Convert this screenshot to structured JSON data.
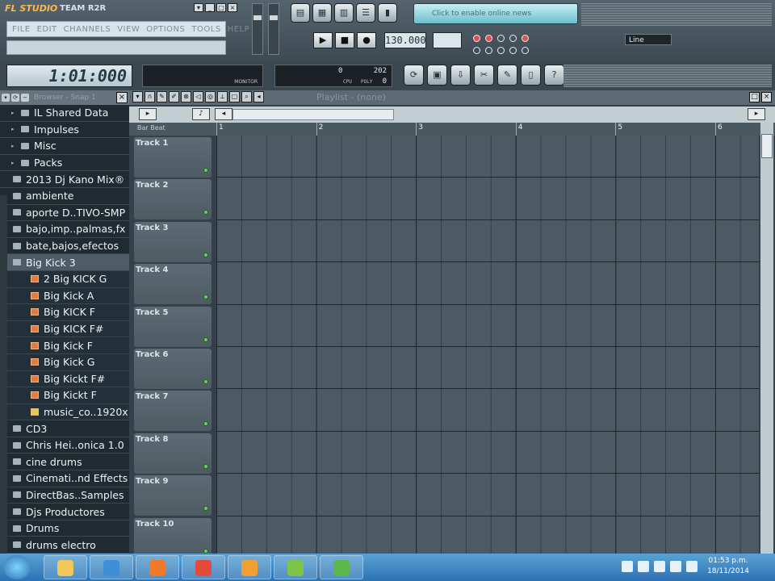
{
  "app": {
    "logo": "FL STUDIO",
    "team": "TEAM R2R",
    "menu": [
      "FILE",
      "EDIT",
      "CHANNELS",
      "VIEW",
      "OPTIONS",
      "TOOLS",
      "HELP"
    ],
    "time_display": "1:01:000",
    "tempo": "130.000",
    "cpu_value_1": "0",
    "cpu_value_2": "202",
    "cpu_value_3": "0",
    "cpu_label": "CPU",
    "poly_label": "POLY",
    "monitor_label": "MONITOR",
    "line_select": "Line",
    "browser_search": "Click to enable online news"
  },
  "browser": {
    "title": "Browser - Snap 1",
    "items": [
      {
        "label": "IL Shared Data",
        "type": "folder",
        "level": 0
      },
      {
        "label": "Impulses",
        "type": "folder",
        "level": 0
      },
      {
        "label": "Misc",
        "type": "folder",
        "level": 0
      },
      {
        "label": "Packs",
        "type": "folder",
        "level": 0
      },
      {
        "label": "2013 Dj Kano Mix®",
        "type": "folder",
        "level": 1
      },
      {
        "label": "ambiente",
        "type": "folder",
        "level": 1
      },
      {
        "label": "aporte D..TIVO-SMP",
        "type": "folder",
        "level": 1
      },
      {
        "label": "bajo,imp..palmas,fx",
        "type": "folder",
        "level": 1
      },
      {
        "label": "bate,bajos,efectos",
        "type": "folder",
        "level": 1
      },
      {
        "label": "Big Kick 3",
        "type": "folder",
        "level": 1,
        "selected": true
      },
      {
        "label": "2 Big KICK G",
        "type": "file",
        "level": 2
      },
      {
        "label": "Big  Kick A",
        "type": "file",
        "level": 2
      },
      {
        "label": "Big KICK  F",
        "type": "file",
        "level": 2
      },
      {
        "label": "Big KICK F#",
        "type": "file",
        "level": 2
      },
      {
        "label": "Big Kick F",
        "type": "file",
        "level": 2
      },
      {
        "label": "Big Kick G",
        "type": "file",
        "level": 2
      },
      {
        "label": "Big Kickt F#",
        "type": "file",
        "level": 2
      },
      {
        "label": "Big Kickt F",
        "type": "file",
        "level": 2
      },
      {
        "label": "music_co..1920x1080",
        "type": "image",
        "level": 2
      },
      {
        "label": "CD3",
        "type": "folder",
        "level": 1
      },
      {
        "label": "Chris Hei..onica 1.0",
        "type": "folder",
        "level": 1
      },
      {
        "label": "cine drums",
        "type": "folder",
        "level": 1
      },
      {
        "label": "Cinemati..nd Effects",
        "type": "folder",
        "level": 1
      },
      {
        "label": "DirectBas..Samples",
        "type": "folder",
        "level": 1
      },
      {
        "label": "Djs Productores",
        "type": "folder",
        "level": 1
      },
      {
        "label": "Drums",
        "type": "folder",
        "level": 1
      },
      {
        "label": "drums electro",
        "type": "folder",
        "level": 1
      }
    ]
  },
  "playlist": {
    "title": "Playlist - (none)",
    "ruler_label": "Bar   Beat",
    "bars": [
      "1",
      "2",
      "3",
      "4",
      "5",
      "6"
    ],
    "tracks": [
      "Track 1",
      "Track 2",
      "Track 3",
      "Track 4",
      "Track 5",
      "Track 6",
      "Track 7",
      "Track 8",
      "Track 9",
      "Track 10"
    ]
  },
  "taskbar": {
    "time": "01:53 p.m.",
    "date": "18/11/2014",
    "apps": [
      "explorer-icon",
      "ie-icon",
      "media-player-icon",
      "chrome-icon",
      "fl-studio-icon",
      "camtasia-icon",
      "camtasia-recorder-icon"
    ]
  },
  "colors": {
    "accent": "#ffb84a",
    "grid_bg": "#4b5a63",
    "taskbar": "#2c72b4",
    "led_green": "#5ed45c"
  }
}
